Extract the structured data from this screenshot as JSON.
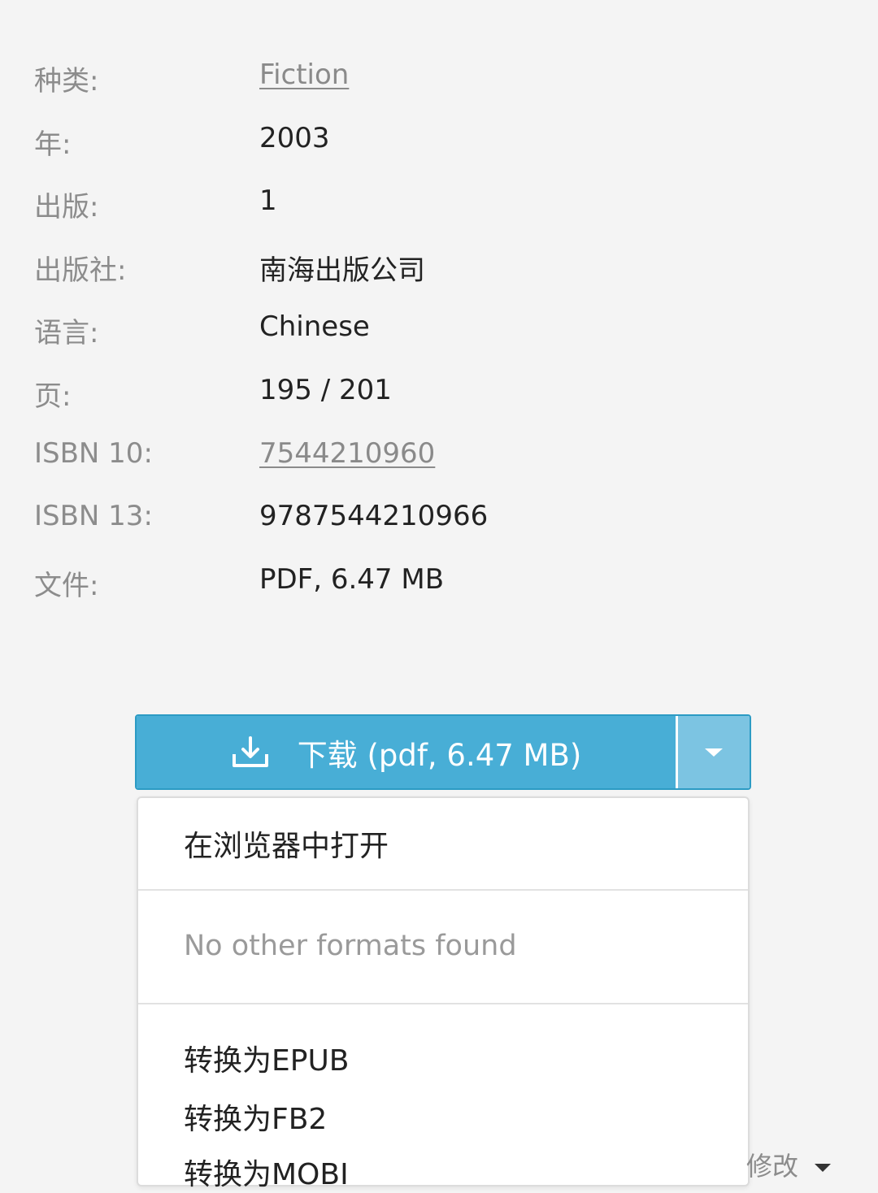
{
  "details": {
    "rows": [
      {
        "label": "种类:",
        "value": "Fiction"
      },
      {
        "label": "年:",
        "value": "2003"
      },
      {
        "label": "出版:",
        "value": "1"
      },
      {
        "label": "出版社:",
        "value": "南海出版公司"
      },
      {
        "label": "语言:",
        "value": "Chinese"
      },
      {
        "label": "页:",
        "value": "195 / 201"
      },
      {
        "label": "ISBN 10:",
        "value": "7544210960"
      },
      {
        "label": "ISBN 13:",
        "value": "9787544210966"
      },
      {
        "label": "文件:",
        "value": "PDF, 6.47 MB"
      }
    ]
  },
  "download": {
    "label": "下载 (pdf, 6.47 MB)",
    "icon": "download-icon",
    "caret_icon": "caret-down-icon"
  },
  "menu": {
    "open_in_browser": "在浏览器中打开",
    "empty_formats": "No other formats found",
    "convert": [
      "转换为EPUB",
      "转换为FB2",
      "转换为MOBI"
    ]
  },
  "edit": {
    "label": "修改"
  },
  "colors": {
    "background": "#f4f4f4",
    "download_main": "#48aed6",
    "download_caret": "#7cc4e2",
    "link_text": "#8a8a8a"
  }
}
